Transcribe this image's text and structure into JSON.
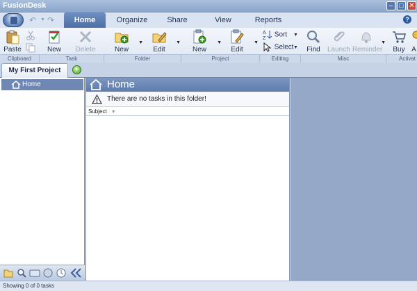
{
  "window": {
    "title": "FusionDesk"
  },
  "ribbon_tabs": [
    "Home",
    "Organize",
    "Share",
    "View",
    "Reports"
  ],
  "ribbon": {
    "clipboard": {
      "paste": "Paste",
      "group": "Clipboard"
    },
    "task": {
      "new_task": "New Task",
      "delete_task": "Delete Task",
      "group": "Task"
    },
    "folder": {
      "new_folder": "New Folder",
      "edit_folder": "Edit Folder",
      "group": "Folder"
    },
    "project": {
      "new_project": "New Project",
      "edit_project": "Edit Project",
      "group": "Project"
    },
    "editing": {
      "sort": "Sort",
      "select": "Select",
      "group": "Editing"
    },
    "misc": {
      "find": "Find",
      "launch": "Launch",
      "reminder": "Reminder",
      "group": "Misc"
    },
    "activation": {
      "buy": "Buy",
      "activate": "A",
      "group": "Activat"
    }
  },
  "project_tab": {
    "label": "My First Project"
  },
  "nav": {
    "home": "Home"
  },
  "main": {
    "header": "Home",
    "empty_message": "There are no tasks in this folder!",
    "column_subject": "Subject"
  },
  "status": {
    "text": "Showing 0 of 0 tasks"
  },
  "colors": {
    "accent": "#4d6fa5",
    "right_pane": "#95a8c7",
    "nav_selected": "#6f87b3"
  }
}
